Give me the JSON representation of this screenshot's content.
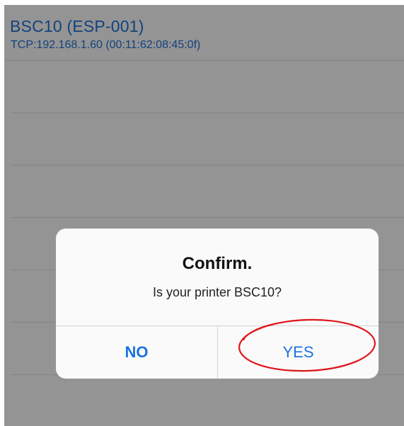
{
  "device": {
    "name": "BSC10 (ESP-001)",
    "address": "TCP:192.168.1.60 (00:11:62:08:45:0f)"
  },
  "alert": {
    "title": "Confirm.",
    "message": "Is your printer BSC10?",
    "no_label": "NO",
    "yes_label": "YES"
  },
  "colors": {
    "link_blue": "#1a73e0",
    "annotation_red": "#e0161c"
  }
}
